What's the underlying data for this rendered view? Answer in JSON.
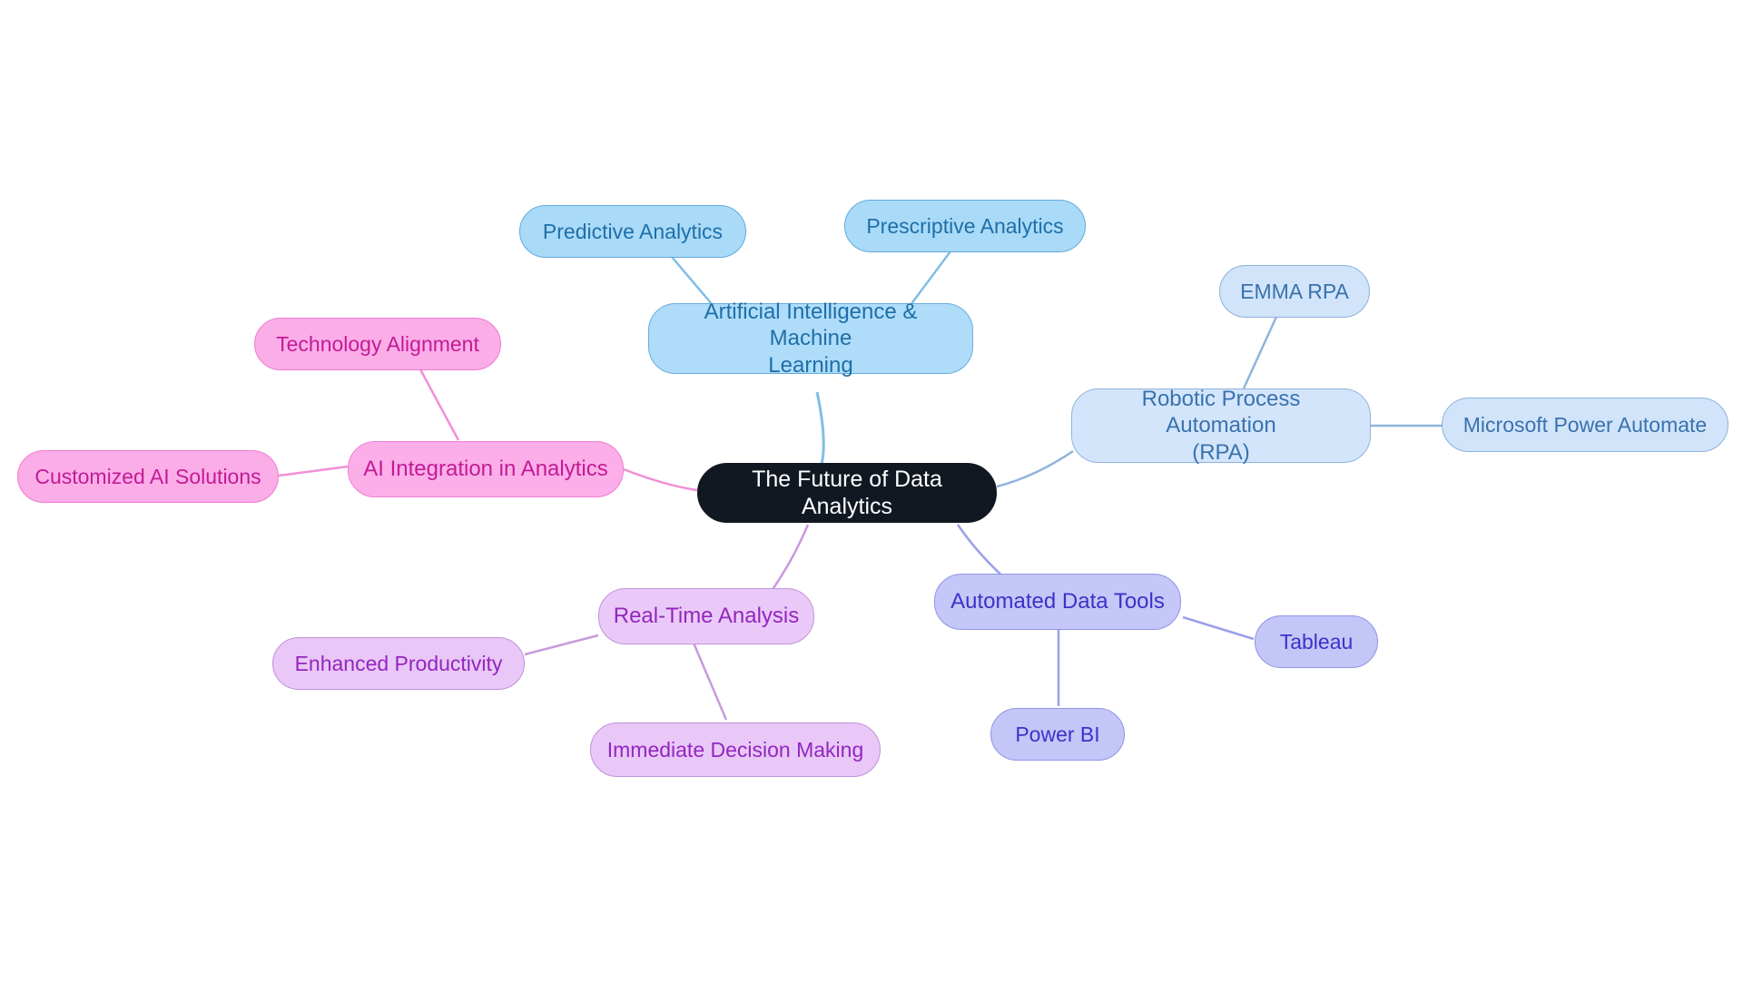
{
  "diagram": {
    "type": "mindmap",
    "title": "The Future of Data Analytics",
    "background": "#ffffff",
    "root": {
      "id": "root",
      "label": "The Future of Data Analytics",
      "fill": "#111822",
      "text_color": "#ffffff"
    },
    "branches": [
      {
        "id": "aiml",
        "label": "Artificial Intelligence & Machine Learning",
        "fill": "#aedcf9",
        "stroke": "#6aaedd",
        "text_color": "#1f6fa8",
        "edge_color": "#7fbfe4",
        "children": [
          {
            "id": "predictive-analytics",
            "label": "Predictive Analytics"
          },
          {
            "id": "prescriptive-analytics",
            "label": "Prescriptive Analytics"
          }
        ]
      },
      {
        "id": "rpa",
        "label": "Robotic Process Automation (RPA)",
        "fill": "#d3e5fb",
        "stroke": "#8fb4dd",
        "text_color": "#3a72ad",
        "edge_color": "#8fb4dd",
        "children": [
          {
            "id": "emma-rpa",
            "label": "EMMA RPA"
          },
          {
            "id": "microsoft-power-automate",
            "label": "Microsoft Power Automate"
          }
        ]
      },
      {
        "id": "tools",
        "label": "Automated Data Tools",
        "fill": "#c4c7f7",
        "stroke": "#9196e4",
        "text_color": "#3b32c9",
        "edge_color": "#9ba0e8",
        "children": [
          {
            "id": "tableau",
            "label": "Tableau"
          },
          {
            "id": "power-bi",
            "label": "Power BI"
          }
        ]
      },
      {
        "id": "realtime",
        "label": "Real-Time Analysis",
        "fill": "#eac9f8",
        "stroke": "#c294da",
        "text_color": "#9326c0",
        "edge_color": "#c89ade",
        "children": [
          {
            "id": "enhanced-productivity",
            "label": "Enhanced Productivity"
          },
          {
            "id": "immediate-decision-making",
            "label": "Immediate Decision Making"
          }
        ]
      },
      {
        "id": "aiintg",
        "label": "AI Integration in Analytics",
        "fill": "#fcaee8",
        "stroke": "#f07ed1",
        "text_color": "#c21b97",
        "edge_color": "#f18fd6",
        "children": [
          {
            "id": "technology-alignment",
            "label": "Technology Alignment"
          },
          {
            "id": "customized-ai-solutions",
            "label": "Customized AI Solutions"
          }
        ]
      }
    ],
    "nodes": {
      "root": "The Future of Data Analytics",
      "aiml": "Artificial Intelligence & Machine\nLearning",
      "predictive_analytics": "Predictive Analytics",
      "prescriptive_analytics": "Prescriptive Analytics",
      "rpa": "Robotic Process Automation\n(RPA)",
      "emma_rpa": "EMMA RPA",
      "microsoft_power_automate": "Microsoft Power Automate",
      "automated_data_tools": "Automated Data Tools",
      "tableau": "Tableau",
      "power_bi": "Power BI",
      "real_time_analysis": "Real-Time Analysis",
      "enhanced_productivity": "Enhanced Productivity",
      "immediate_decision_making": "Immediate Decision Making",
      "ai_integration": "AI Integration in Analytics",
      "technology_alignment": "Technology Alignment",
      "customized_ai_solutions": "Customized AI Solutions"
    }
  }
}
